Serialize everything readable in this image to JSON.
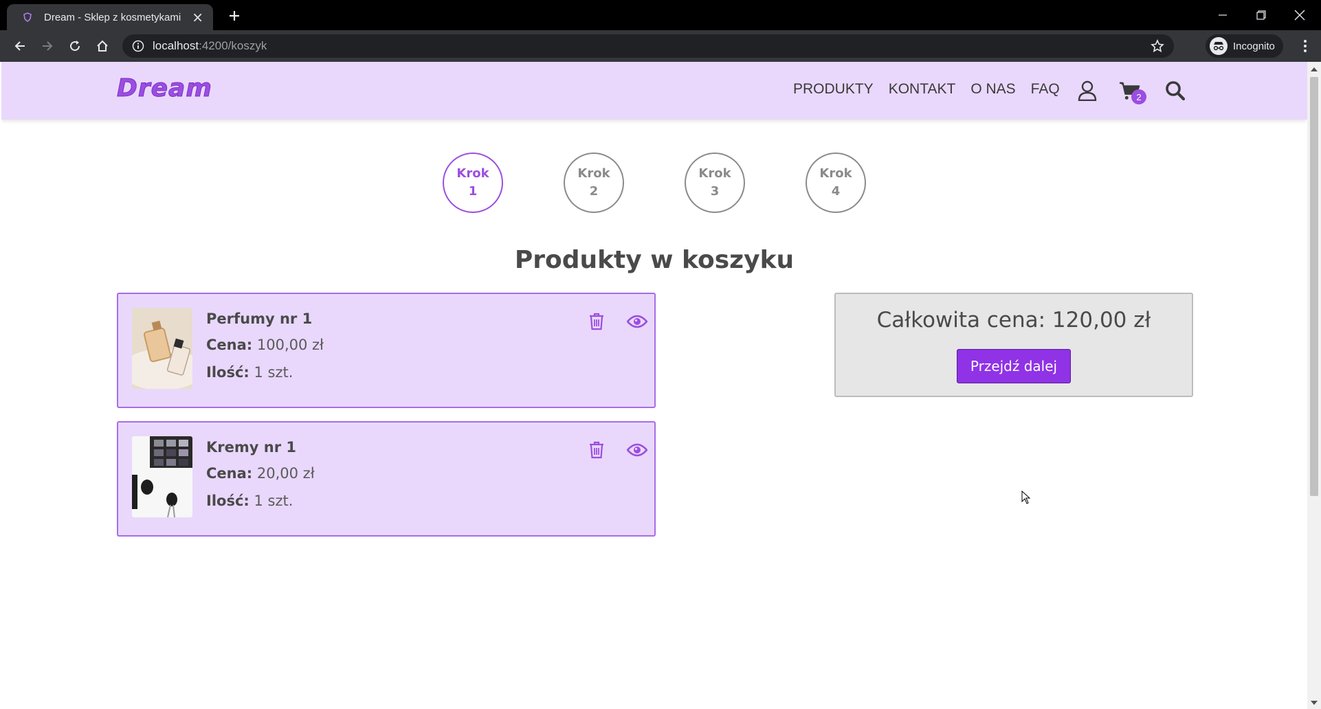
{
  "browser": {
    "tab_title": "Dream - Sklep z kosmetykami",
    "url_host": "localhost",
    "url_rest": ":4200/koszyk",
    "profile_label": "Incognito"
  },
  "site": {
    "logo": "Dream",
    "nav": [
      "PRODUKTY",
      "KONTAKT",
      "O NAS",
      "FAQ"
    ],
    "cart_count": "2",
    "accent_color": "#9b4ee0",
    "header_bg": "#e9d8fc"
  },
  "steps": [
    {
      "label": "Krok",
      "num": "1",
      "active": true
    },
    {
      "label": "Krok",
      "num": "2",
      "active": false
    },
    {
      "label": "Krok",
      "num": "3",
      "active": false
    },
    {
      "label": "Krok",
      "num": "4",
      "active": false
    }
  ],
  "page_title": "Produkty w koszyku",
  "cart_items": [
    {
      "name": "Perfumy nr 1",
      "price_label": "Cena:",
      "price": "100,00 zł",
      "qty_label": "Ilość:",
      "qty": "1 szt."
    },
    {
      "name": "Kremy nr 1",
      "price_label": "Cena:",
      "price": "20,00 zł",
      "qty_label": "Ilość:",
      "qty": "1 szt."
    }
  ],
  "summary": {
    "total_text": "Całkowita cena: 120,00 zł",
    "next_button": "Przejdź dalej"
  }
}
